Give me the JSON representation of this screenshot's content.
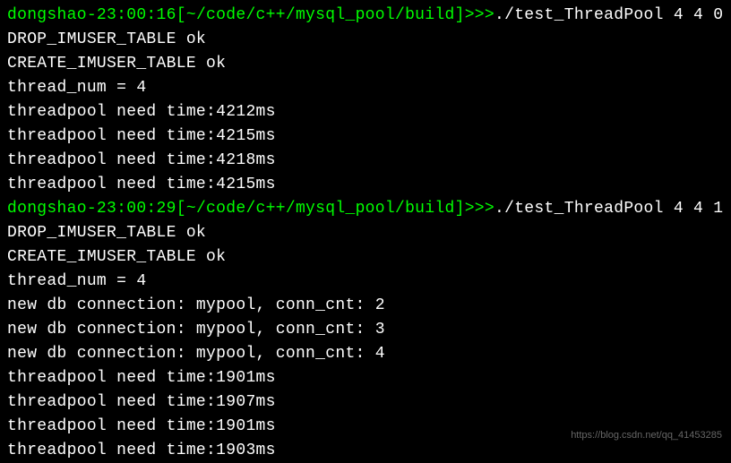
{
  "terminal": {
    "session1": {
      "prompt_user": "dongshao-23:00:16",
      "prompt_path": "[~/code/c++/mysql_pool/build]",
      "prompt_marker": ">>>",
      "command": "./test_ThreadPool 4 4 0",
      "output": [
        "DROP_IMUSER_TABLE ok",
        "CREATE_IMUSER_TABLE ok",
        "thread_num = 4",
        "threadpool need time:4212ms",
        "threadpool need time:4215ms",
        "threadpool need time:4218ms",
        "threadpool need time:4215ms"
      ]
    },
    "session2": {
      "prompt_user": "dongshao-23:00:29",
      "prompt_path": "[~/code/c++/mysql_pool/build]",
      "prompt_marker": ">>>",
      "command": "./test_ThreadPool 4 4 1",
      "output": [
        "DROP_IMUSER_TABLE ok",
        "CREATE_IMUSER_TABLE ok",
        "thread_num = 4",
        "new db connection: mypool, conn_cnt: 2",
        "new db connection: mypool, conn_cnt: 3",
        "new db connection: mypool, conn_cnt: 4",
        "threadpool need time:1901ms",
        "threadpool need time:1907ms",
        "threadpool need time:1901ms",
        "threadpool need time:1903ms"
      ]
    }
  },
  "watermark": "https://blog.csdn.net/qq_41453285"
}
